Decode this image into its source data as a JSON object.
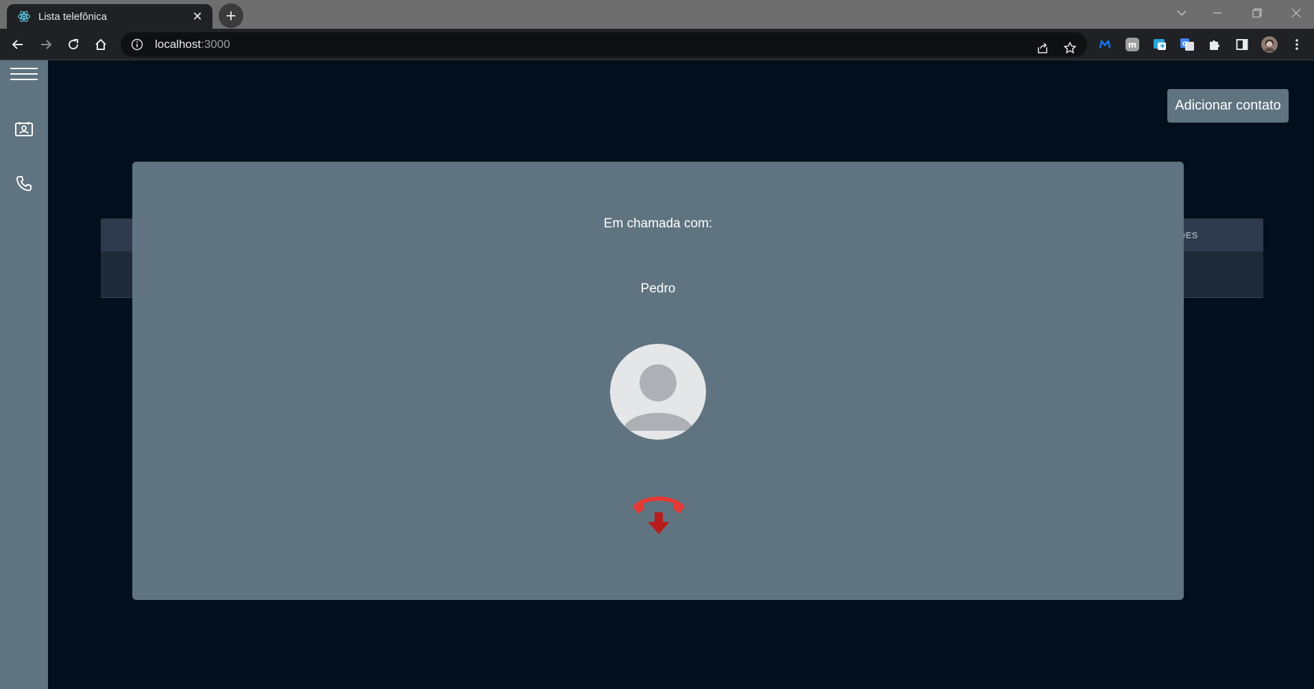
{
  "browser": {
    "tab_title": "Lista telefônica",
    "tab_close": "✕",
    "new_tab": "+",
    "url_host": "localhost",
    "url_port": ":3000",
    "favicon": "react-icon",
    "window_controls": [
      "chevron-down-icon",
      "minimize-icon",
      "restore-icon",
      "close-icon"
    ],
    "extensions": [
      "malwarebytes-icon",
      "m-extension-icon",
      "translate-tab-icon",
      "google-translate-icon",
      "puzzle-icon",
      "side-panel-icon",
      "profile-avatar",
      "kebab-menu-icon"
    ]
  },
  "sidebar": {
    "items": [
      {
        "icon": "hamburger-menu-icon"
      },
      {
        "icon": "contacts-card-icon"
      },
      {
        "icon": "phone-icon"
      }
    ]
  },
  "header": {
    "add_contact_label": "Adicionar contato"
  },
  "table": {
    "partial_header": "ÕES"
  },
  "call_modal": {
    "title": "Em chamada com:",
    "contact_name": "Pedro",
    "avatar": "default-user-avatar",
    "end_call_icon": "hang-up-icon"
  },
  "colors": {
    "sidebar": "#5f7480",
    "background": "#01101c",
    "modal": "#5f7480",
    "hangup_red": "#e53935",
    "hangup_arrow": "#b71c1c"
  }
}
